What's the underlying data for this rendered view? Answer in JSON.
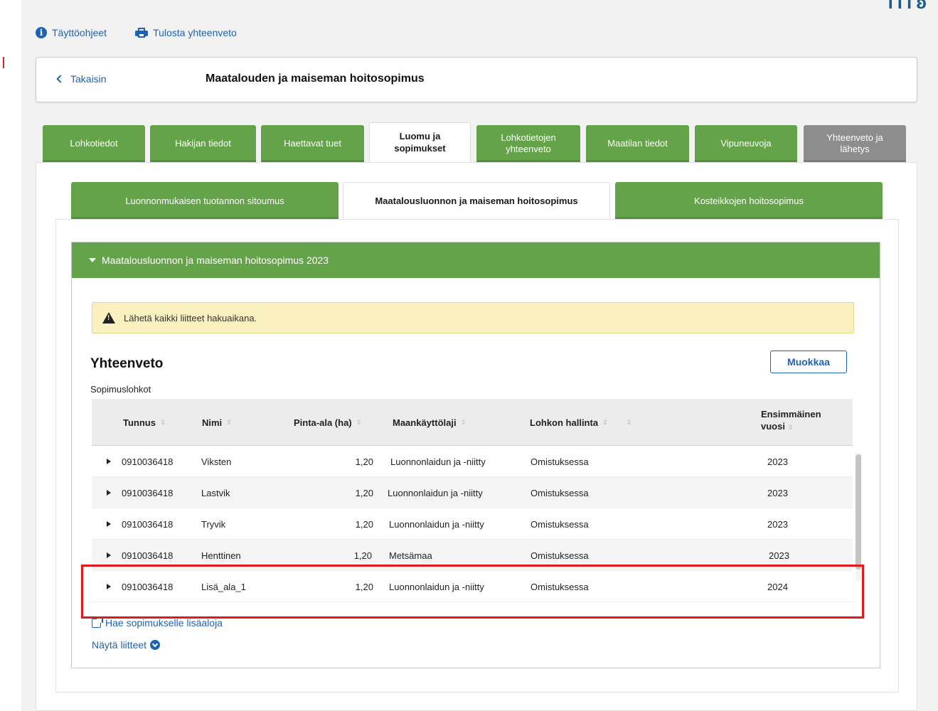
{
  "top_links": {
    "instructions": "Täyttöohjeet",
    "print": "Tulosta yhteenveto"
  },
  "header": {
    "back": "Takaisin",
    "title": "Maatalouden ja maiseman hoitosopimus"
  },
  "main_tabs": [
    {
      "label": "Lohkotiedot"
    },
    {
      "label": "Hakijan tiedot"
    },
    {
      "label": "Haettavat tuet"
    },
    {
      "label": "Luomu ja sopimukset"
    },
    {
      "label": "Lohkotietojen yhteenveto"
    },
    {
      "label": "Maatilan tiedot"
    },
    {
      "label": "Vipuneuvoja"
    },
    {
      "label": "Yhteenveto ja lähetys"
    }
  ],
  "sub_tabs": [
    {
      "label": "Luonnonmukaisen tuotannon sitoumus"
    },
    {
      "label": "Maatalousluonnon ja maiseman hoitosopimus"
    },
    {
      "label": "Kosteikkojen hoitosopimus"
    }
  ],
  "accordion": {
    "title": "Maatalousluonnon ja maiseman hoitosopimus 2023"
  },
  "warning": "Lähetä kaikki liitteet hakuaikana.",
  "summary": {
    "title": "Yhteenveto",
    "edit_button": "Muokkaa",
    "section_label": "Sopimuslohkot"
  },
  "table": {
    "columns": {
      "tunnus": "Tunnus",
      "nimi": "Nimi",
      "pinta_ala": "Pinta-ala (ha)",
      "maankayttolaji": "Maankäyttölaji",
      "hallinta": "Lohkon hallinta",
      "vuosi_line1": "Ensimmäinen",
      "vuosi_line2": "vuosi"
    },
    "rows": [
      {
        "tunnus": "0910036418",
        "nimi": "Viksten",
        "pinta_ala": "1,20",
        "maankayttolaji": "Luonnonlaidun ja -niitty",
        "hallinta": "Omistuksessa",
        "vuosi": "2023"
      },
      {
        "tunnus": "0910036418",
        "nimi": "Lastvik",
        "pinta_ala": "1,20",
        "maankayttolaji": "Luonnonlaidun ja -niitty",
        "hallinta": "Omistuksessa",
        "vuosi": "2023"
      },
      {
        "tunnus": "0910036418",
        "nimi": "Tryvik",
        "pinta_ala": "1,20",
        "maankayttolaji": "Luonnonlaidun ja -niitty",
        "hallinta": "Omistuksessa",
        "vuosi": "2023"
      },
      {
        "tunnus": "0910036418",
        "nimi": "Henttinen",
        "pinta_ala": "1,20",
        "maankayttolaji": "Metsämaa",
        "hallinta": "Omistuksessa",
        "vuosi": "2023"
      },
      {
        "tunnus": "0910036418",
        "nimi": "Lisä_ala_1",
        "pinta_ala": "1,20",
        "maankayttolaji": "Luonnonlaidun ja -niitty",
        "hallinta": "Omistuksessa",
        "vuosi": "2024"
      }
    ]
  },
  "links": {
    "add_areas": "Hae sopimukselle lisäaloja",
    "show_attachments": "Näytä liitteet"
  },
  "colors": {
    "tab_green": "#64a34a",
    "tab_gray": "#8d8d8d",
    "link_blue": "#1e62b3",
    "warning_bg": "#fbf0c0",
    "highlight_red": "#e0191b"
  }
}
